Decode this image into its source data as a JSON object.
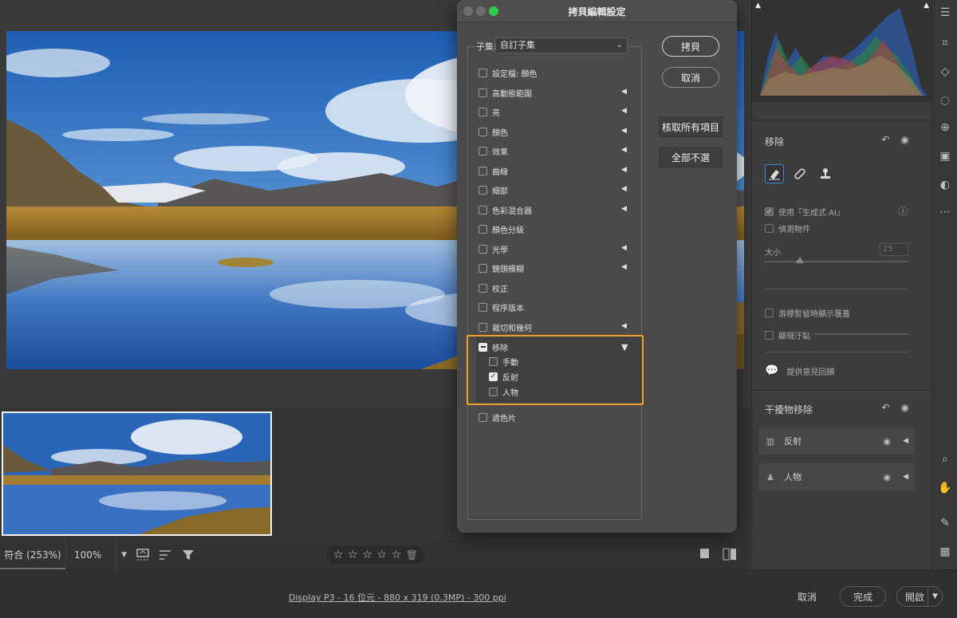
{
  "dialog": {
    "title": "拷貝編輯設定",
    "subset_label": "子集:",
    "subset_value": "自訂子集",
    "buttons": {
      "copy": "拷貝",
      "cancel": "取消",
      "select_all": "核取所有項目",
      "select_none": "全部不選"
    },
    "options": [
      {
        "label": "設定檔: 顏色",
        "has_arrow": false
      },
      {
        "label": "高動態範圍",
        "has_arrow": true
      },
      {
        "label": "亮",
        "has_arrow": true
      },
      {
        "label": "顏色",
        "has_arrow": true
      },
      {
        "label": "效果",
        "has_arrow": true
      },
      {
        "label": "曲線",
        "has_arrow": true
      },
      {
        "label": "細部",
        "has_arrow": true
      },
      {
        "label": "色彩混合器",
        "has_arrow": true
      },
      {
        "label": "顏色分級",
        "has_arrow": false
      },
      {
        "label": "光學",
        "has_arrow": true
      },
      {
        "label": "鏡頭模糊",
        "has_arrow": true
      },
      {
        "label": "校正",
        "has_arrow": false
      },
      {
        "label": "程序版本",
        "has_arrow": false
      },
      {
        "label": "裁切和幾何",
        "has_arrow": true
      }
    ],
    "remove_group": {
      "label": "移除",
      "children": [
        {
          "label": "手動",
          "checked": false
        },
        {
          "label": "反射",
          "checked": true
        },
        {
          "label": "人物",
          "checked": false
        }
      ]
    },
    "last_option": "遮色片"
  },
  "toolbar": {
    "zoom_fit": "符合 (253%)",
    "zoom_percent": "100%"
  },
  "statusbar": {
    "file_info": "Display P3 - 16 位元 - 880 x 319 (0.3MP) - 300 ppi",
    "cancel": "取消",
    "done": "完成",
    "open": "開啟"
  },
  "right_panel": {
    "remove_title": "移除",
    "use_gen_ai": "使用「生成式 AI」",
    "detect_objects": "偵測物件",
    "size_label": "大小",
    "size_value": "25",
    "show_overlay": "游標暫留時顯示覆蓋",
    "show_spots": "顯現汙點",
    "feedback": "提供意見回饋",
    "distraction_title": "干擾物移除",
    "items": [
      {
        "label": "反射"
      },
      {
        "label": "人物"
      }
    ]
  },
  "colors": {
    "highlight": "#f0a030",
    "dialog_bg": "#4a4a4a",
    "panel_bg": "#3d3d3d",
    "active_tool": "#3d8ad8"
  }
}
